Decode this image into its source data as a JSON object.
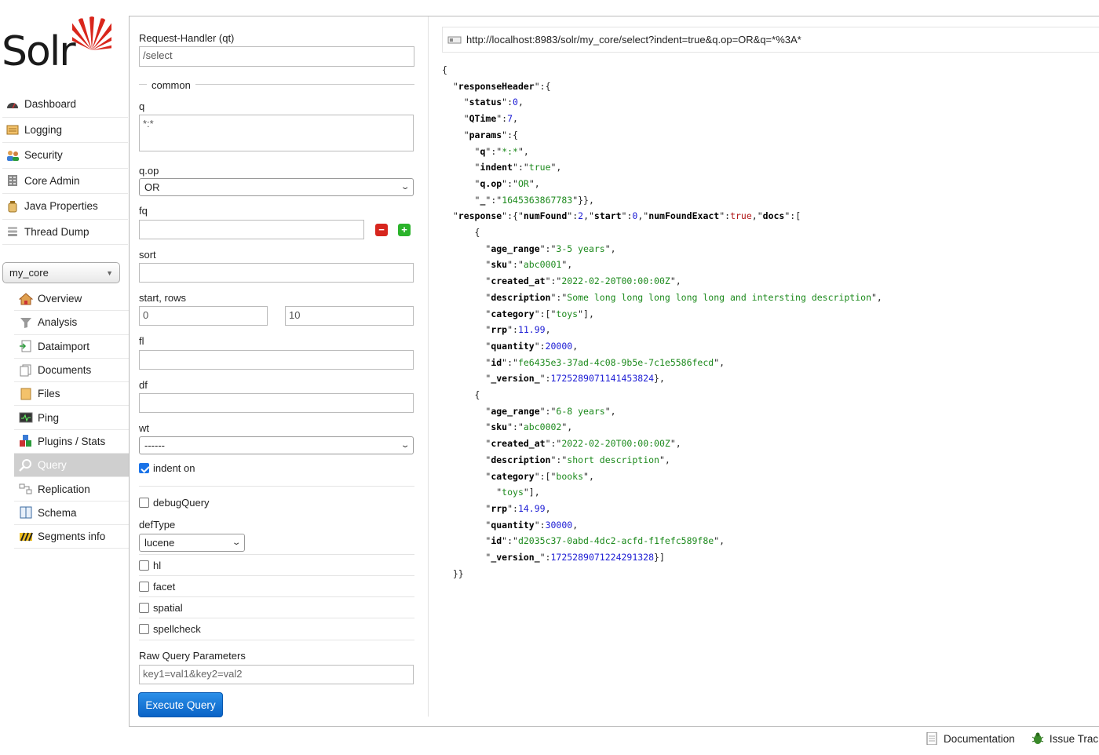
{
  "app": {
    "logo_text": "Solr"
  },
  "nav": {
    "items": [
      {
        "label": "Dashboard",
        "icon": "dashboard-icon"
      },
      {
        "label": "Logging",
        "icon": "logging-icon"
      },
      {
        "label": "Security",
        "icon": "security-icon"
      },
      {
        "label": "Core Admin",
        "icon": "core-admin-icon"
      },
      {
        "label": "Java Properties",
        "icon": "java-properties-icon"
      },
      {
        "label": "Thread Dump",
        "icon": "thread-dump-icon"
      }
    ],
    "core_selector": "my_core",
    "core_items": [
      {
        "label": "Overview",
        "icon": "home-icon"
      },
      {
        "label": "Analysis",
        "icon": "funnel-icon"
      },
      {
        "label": "Dataimport",
        "icon": "dataimport-icon"
      },
      {
        "label": "Documents",
        "icon": "documents-icon"
      },
      {
        "label": "Files",
        "icon": "folder-icon"
      },
      {
        "label": "Ping",
        "icon": "ping-icon"
      },
      {
        "label": "Plugins / Stats",
        "icon": "plugins-icon"
      },
      {
        "label": "Query",
        "icon": "search-icon",
        "active": true
      },
      {
        "label": "Replication",
        "icon": "replication-icon"
      },
      {
        "label": "Schema",
        "icon": "schema-icon"
      },
      {
        "label": "Segments info",
        "icon": "segments-icon"
      }
    ]
  },
  "form": {
    "qt_label": "Request-Handler (qt)",
    "qt_value": "/select",
    "common_legend": "common",
    "q_label": "q",
    "q_value": "*:*",
    "qop_label": "q.op",
    "qop_value": "OR",
    "fq_label": "fq",
    "fq_value": "",
    "sort_label": "sort",
    "sort_value": "",
    "start_rows_label": "start, rows",
    "start_value": "0",
    "rows_value": "10",
    "fl_label": "fl",
    "fl_value": "",
    "df_label": "df",
    "df_value": "",
    "wt_label": "wt",
    "wt_value": "------",
    "indent_label": "indent on",
    "indent_checked": true,
    "debug_label": "debugQuery",
    "deftype_label": "defType",
    "deftype_value": "lucene",
    "hl_label": "hl",
    "facet_label": "facet",
    "spatial_label": "spatial",
    "spellcheck_label": "spellcheck",
    "raw_label": "Raw Query Parameters",
    "raw_placeholder": "key1=val1&key2=val2",
    "execute_label": "Execute Query"
  },
  "result": {
    "url": "http://localhost:8983/solr/my_core/select?indent=true&q.op=OR&q=*%3A*",
    "status": "0",
    "qtime": "7",
    "params": {
      "q": "*:*",
      "indent": "true",
      "q_op": "OR",
      "underscore": "1645363867783"
    },
    "numFound": "2",
    "start": "0",
    "numFoundExact": "true",
    "docs": [
      {
        "age_range": "3-5 years",
        "sku": "abc0001",
        "created_at": "2022-02-20T00:00:00Z",
        "description": "Some long long long long long and intersting description",
        "category": [
          "toys"
        ],
        "rrp": "11.99",
        "quantity": "20000",
        "id": "fe6435e3-37ad-4c08-9b5e-7c1e5586fecd",
        "version": "1725289071141453824"
      },
      {
        "age_range": "6-8 years",
        "sku": "abc0002",
        "created_at": "2022-02-20T00:00:00Z",
        "description": "short description",
        "category": [
          "books",
          "toys"
        ],
        "rrp": "14.99",
        "quantity": "30000",
        "id": "d2035c37-0abd-4dc2-acfd-f1fefc589f8e",
        "version": "1725289071224291328"
      }
    ]
  },
  "footer": {
    "documentation": "Documentation",
    "issue_tracker": "Issue Trac"
  },
  "colors": {
    "accent": "#0a63c6",
    "json_string": "#1d8a1d",
    "json_number": "#1c1cd4",
    "json_bool": "#b01515",
    "active_nav": "#cfcfcf"
  }
}
